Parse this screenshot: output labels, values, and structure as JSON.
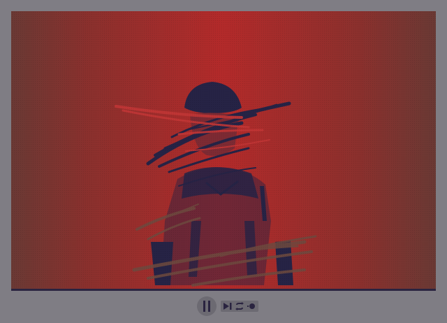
{
  "player": {
    "state": "paused",
    "colors": {
      "frame": "#7f7d84",
      "background_center": "#b32a2a",
      "background_edge": "#6a3934",
      "ink": "#2a2440",
      "control_fill": "#6c6a72"
    },
    "icons": {
      "pause": "pause-icon",
      "step_forward": "step-forward-icon",
      "loop": "loop-icon",
      "record": "record-icon"
    }
  }
}
